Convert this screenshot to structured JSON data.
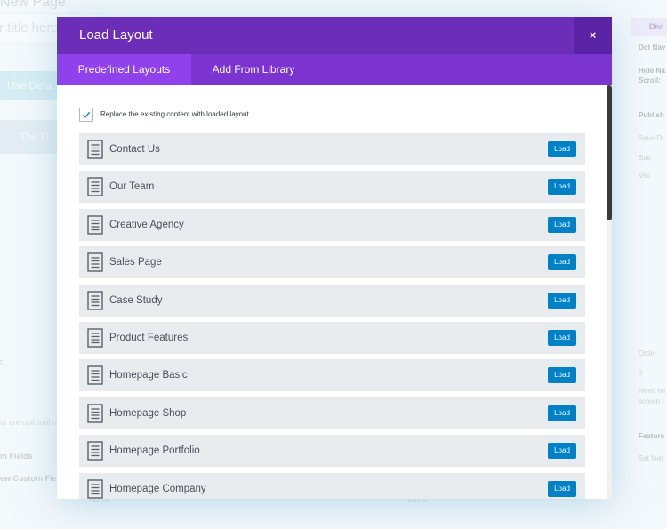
{
  "background": {
    "page_title": "New Page",
    "title_placeholder": "r title here",
    "default_button": "Use Defa",
    "builder_button": "The D",
    "text_a": "t:",
    "text_b": "ts are optional m",
    "text_c": "m Fields",
    "text_d": "ew Custom Field",
    "col_name": "Name",
    "col_value": "Value",
    "side_header": "Divi",
    "side_items": [
      "Dot Nav",
      "Hide Na",
      "Scroll:",
      "Publish",
      "Save Dr",
      "Stat",
      "Visi",
      "Order",
      "0",
      "Need he",
      "screen t",
      "Feature",
      "Set feat"
    ]
  },
  "modal": {
    "title": "Load Layout",
    "close_glyph": "×",
    "tabs": [
      {
        "label": "Predefined Layouts",
        "active": true
      },
      {
        "label": "Add From Library",
        "active": false
      }
    ],
    "replace_checkbox": {
      "label": "Replace the existing content with loaded layout",
      "checked": true
    },
    "load_label": "Load",
    "layouts": [
      {
        "name": "Contact Us"
      },
      {
        "name": "Our Team"
      },
      {
        "name": "Creative Agency"
      },
      {
        "name": "Sales Page"
      },
      {
        "name": "Case Study"
      },
      {
        "name": "Product Features"
      },
      {
        "name": "Homepage Basic"
      },
      {
        "name": "Homepage Shop"
      },
      {
        "name": "Homepage Portfolio"
      },
      {
        "name": "Homepage Company"
      }
    ]
  },
  "colors": {
    "header": "#6c2eb9",
    "tabs": "#7b34cf",
    "active_tab": "#8f42ec",
    "load_button": "#0081c6",
    "item_background": "#e9ecef",
    "checkmark": "#1e8cbe"
  },
  "icons": {
    "layout_item": "document-icon",
    "checkbox": "checkmark-icon",
    "close": "close-icon"
  }
}
